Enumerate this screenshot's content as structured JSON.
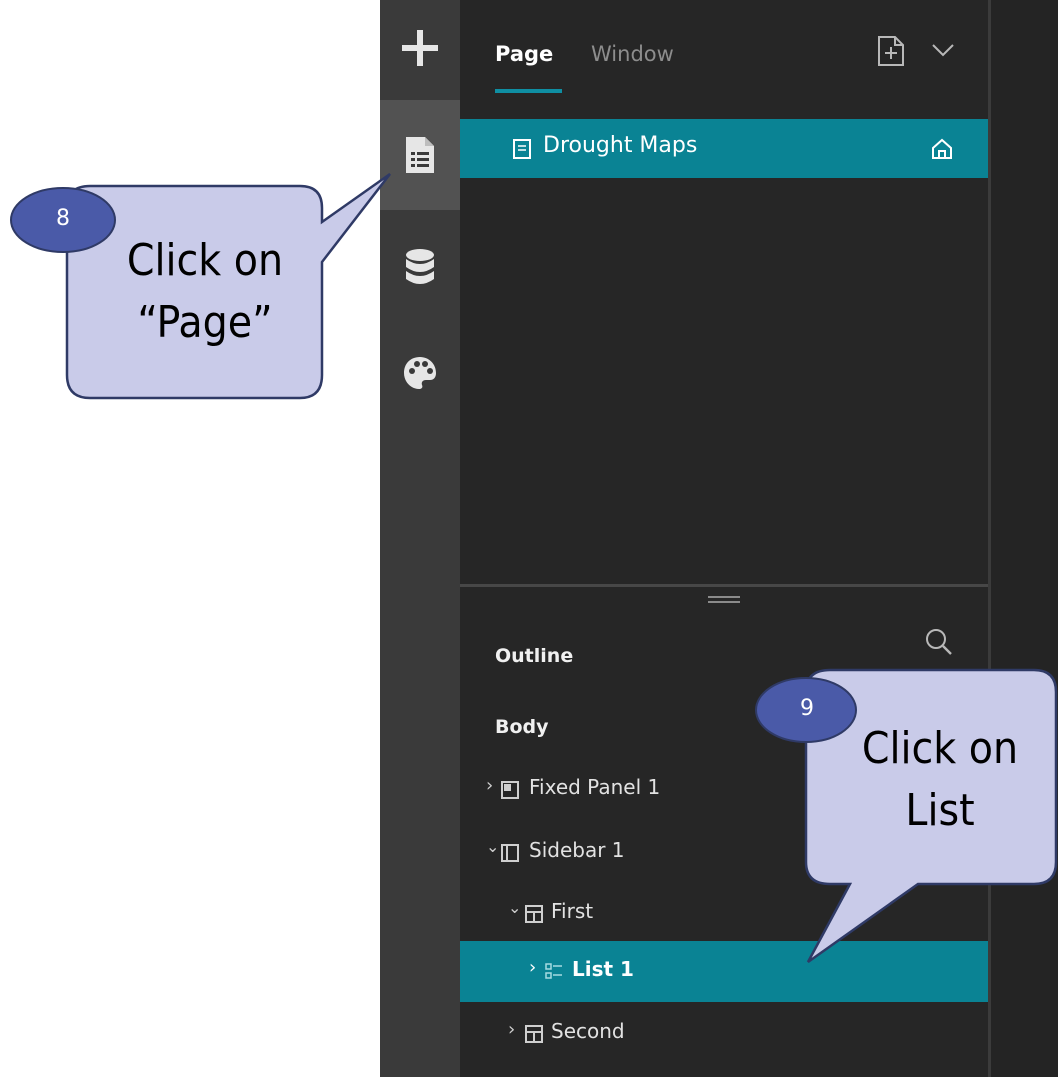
{
  "panel": {
    "tabs": [
      {
        "label": "Page",
        "active": true
      },
      {
        "label": "Window",
        "active": false
      }
    ],
    "pages": [
      {
        "label": "Drought Maps",
        "home": true,
        "selected": true
      }
    ]
  },
  "outline": {
    "title": "Outline",
    "root": "Body",
    "items": [
      {
        "label": "Fixed Panel 1",
        "expanded": false,
        "selected": false
      },
      {
        "label": "Sidebar 1",
        "expanded": true,
        "selected": false
      },
      {
        "label": "First",
        "expanded": true,
        "selected": false
      },
      {
        "label": "List 1",
        "expanded": false,
        "selected": true
      },
      {
        "label": "Second",
        "expanded": false,
        "selected": false
      }
    ]
  },
  "rail": {
    "items": [
      "add-icon",
      "page-icon",
      "data-icon",
      "theme-icon"
    ],
    "active": "page-icon"
  },
  "callouts": [
    {
      "badge": "8",
      "line1": "Click on",
      "line2": "“Page”"
    },
    {
      "badge": "9",
      "line1": "Click on",
      "line2": "List"
    }
  ],
  "colors": {
    "accent": "#0a8394",
    "panel": "#262626",
    "rail": "#3a3a3a",
    "callout_fill": "#c9cbe9",
    "callout_stroke": "#2f3a66",
    "badge_fill": "#4a5aa8"
  }
}
